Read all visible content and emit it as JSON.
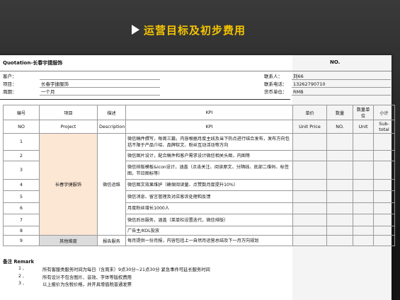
{
  "page": {
    "heading": "运营目标及初步费用"
  },
  "document": {
    "title": "Quotation-长春宇捷服饰",
    "no_label": "NO.",
    "left_meta": [
      {
        "label": "客户：",
        "value": ""
      },
      {
        "label": "项目：",
        "value": "长春宇捷服饰"
      },
      {
        "label": "周期：",
        "value": "一个月"
      }
    ],
    "right_meta": [
      {
        "label": "联系人：",
        "value": "刘66"
      },
      {
        "label": "联系电话：",
        "value": "13262790710"
      },
      {
        "label": "货币单位：",
        "value": "RMB"
      }
    ]
  },
  "table": {
    "headers_cn": [
      "编号",
      "项目",
      "描述",
      "KPI",
      "单价",
      "数量",
      "数量单位",
      "小计"
    ],
    "headers_en": [
      "NO",
      "Project",
      "Description",
      "KPI",
      "Unit Price",
      "NO.",
      "Unit",
      "Sub-total"
    ],
    "project_main": "长春宇捷服饰",
    "desc_main": "微信运维",
    "rows": [
      {
        "no": "1",
        "kpi": "微信稿件撰写，每周三篇，内容根据月度主线及当下热点进行结合发布，发布方向包括不限于产品介绍、品牌软文、粉丝互动活动等方向"
      },
      {
        "no": "2",
        "kpi": "微信图片设计，配合稿件和客户需求设计微信相关头图，内图等"
      },
      {
        "no": "3",
        "kpi": "微信排版模板&icon设计，涵盖（点击关注、阅读原文、分隔线、底部二维码、标签图，节日图标等）"
      },
      {
        "no": "4",
        "kpi": "微信图文效果维护（确保阅读量、点赞数月度提升10%）"
      },
      {
        "no": "5",
        "kpi": "微信消息、留言管理及对应客诉处理和反馈"
      },
      {
        "no": "6",
        "kpi": "月度粉丝增长1000人"
      },
      {
        "no": "7",
        "kpi": "微信后台服务，涵盖（菜单栏设置迭代，微信排版）"
      },
      {
        "no": "8",
        "kpi": "广告主/KOL投放"
      }
    ],
    "last_row": {
      "no": "9",
      "project": "其他维度",
      "desc": "报告服务",
      "kpi": "每月提供一份月报，内容包括上一自然月运营总结及下一月方向规划"
    }
  },
  "remarks": {
    "title": "备注 Remark",
    "items": [
      {
        "num": "1 ,",
        "text": "所有客服类服务时间为每日（含周末）9点30分~21点30分 紧急事件可延长服务时间"
      },
      {
        "num": "2 ,",
        "text": "所有设计不包含图片、音效、字体等版权费用"
      },
      {
        "num": "3 ,",
        "text": "以上报价为含税价格，并开具增值税普通发票"
      }
    ]
  },
  "colors": {
    "heading": "#f5c400",
    "peach": "#fce6d4",
    "gray": "#dcdcdc"
  }
}
